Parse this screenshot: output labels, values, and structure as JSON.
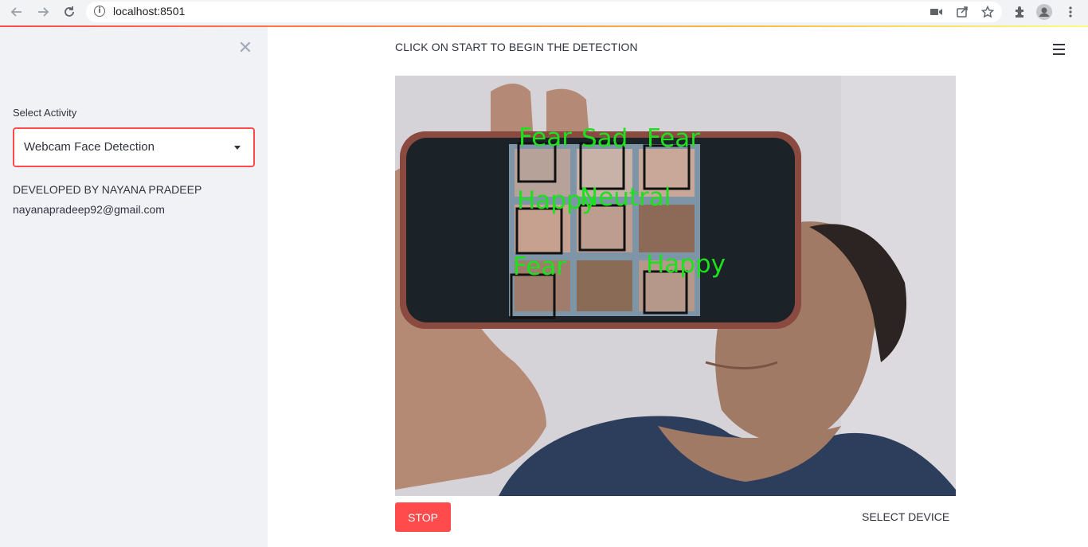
{
  "browser": {
    "url": "localhost:8501"
  },
  "sidebar": {
    "select_label": "Select Activity",
    "select_value": "Webcam Face Detection",
    "developer_line": "DEVELOPED BY NAYANA PRADEEP",
    "email": "nayanapradeep92@gmail.com"
  },
  "main": {
    "heading": "CLICK ON START TO BEGIN THE DETECTION",
    "detections": [
      {
        "label": "Fear"
      },
      {
        "label": "Sad"
      },
      {
        "label": "Fear"
      },
      {
        "label": "Happy"
      },
      {
        "label": "Neutral"
      },
      {
        "label": "Fear"
      },
      {
        "label": "Happy"
      }
    ],
    "stop_label": "STOP",
    "select_device_label": "SELECT DEVICE"
  },
  "colors": {
    "accent": "#ff4b4b",
    "sidebar_bg": "#f0f2f6",
    "detection_label": "#1ee01e",
    "text": "#31333f"
  }
}
